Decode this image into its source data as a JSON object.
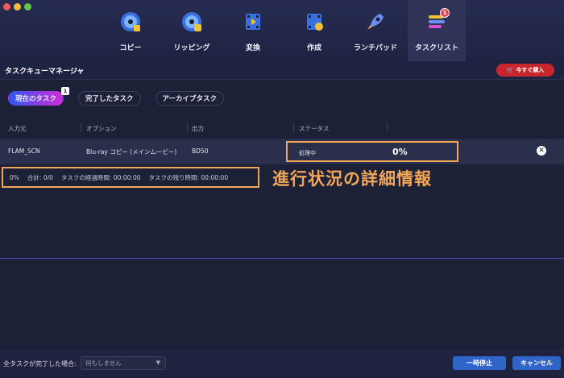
{
  "toolbar": {
    "items": [
      {
        "label": "コピー",
        "icon": "disc-copy-icon"
      },
      {
        "label": "リッピング",
        "icon": "disc-rip-icon"
      },
      {
        "label": "変換",
        "icon": "film-convert-icon"
      },
      {
        "label": "作成",
        "icon": "film-create-icon"
      },
      {
        "label": "ランチパッド",
        "icon": "rocket-icon"
      },
      {
        "label": "タスクリスト",
        "icon": "task-list-icon",
        "badge": "1",
        "active": true
      }
    ]
  },
  "header": {
    "title": "タスクキューマネージャ",
    "buy_label": "今すぐ購入"
  },
  "tabs": [
    {
      "label": "現在のタスク",
      "count": "1",
      "active": true
    },
    {
      "label": "完了したタスク"
    },
    {
      "label": "アーカイブタスク"
    }
  ],
  "table": {
    "columns": [
      "入力元",
      "オプション",
      "出力",
      "ステータス"
    ],
    "rows": [
      {
        "source": "FLAM_SCN",
        "option": "Blu-ray コピー (メインムービー)",
        "output": "BD50",
        "status": "処理中",
        "progress": "0%"
      }
    ]
  },
  "progress_summary": {
    "percent": "0%",
    "total": "合計: 0/0",
    "elapsed": "タスクの経過時間: 00:00:00",
    "remaining": "タスクの残り時間: 00:00:00"
  },
  "annotation": "進行状況の詳細情報",
  "footer": {
    "label": "全タスクが完了した場合:",
    "select_value": "何もしません",
    "pause_label": "一時停止",
    "cancel_label": "キャンセル"
  },
  "colors": {
    "highlight": "#f3a655",
    "accent_blue": "#2f64c9",
    "buy_red": "#c7262e"
  }
}
